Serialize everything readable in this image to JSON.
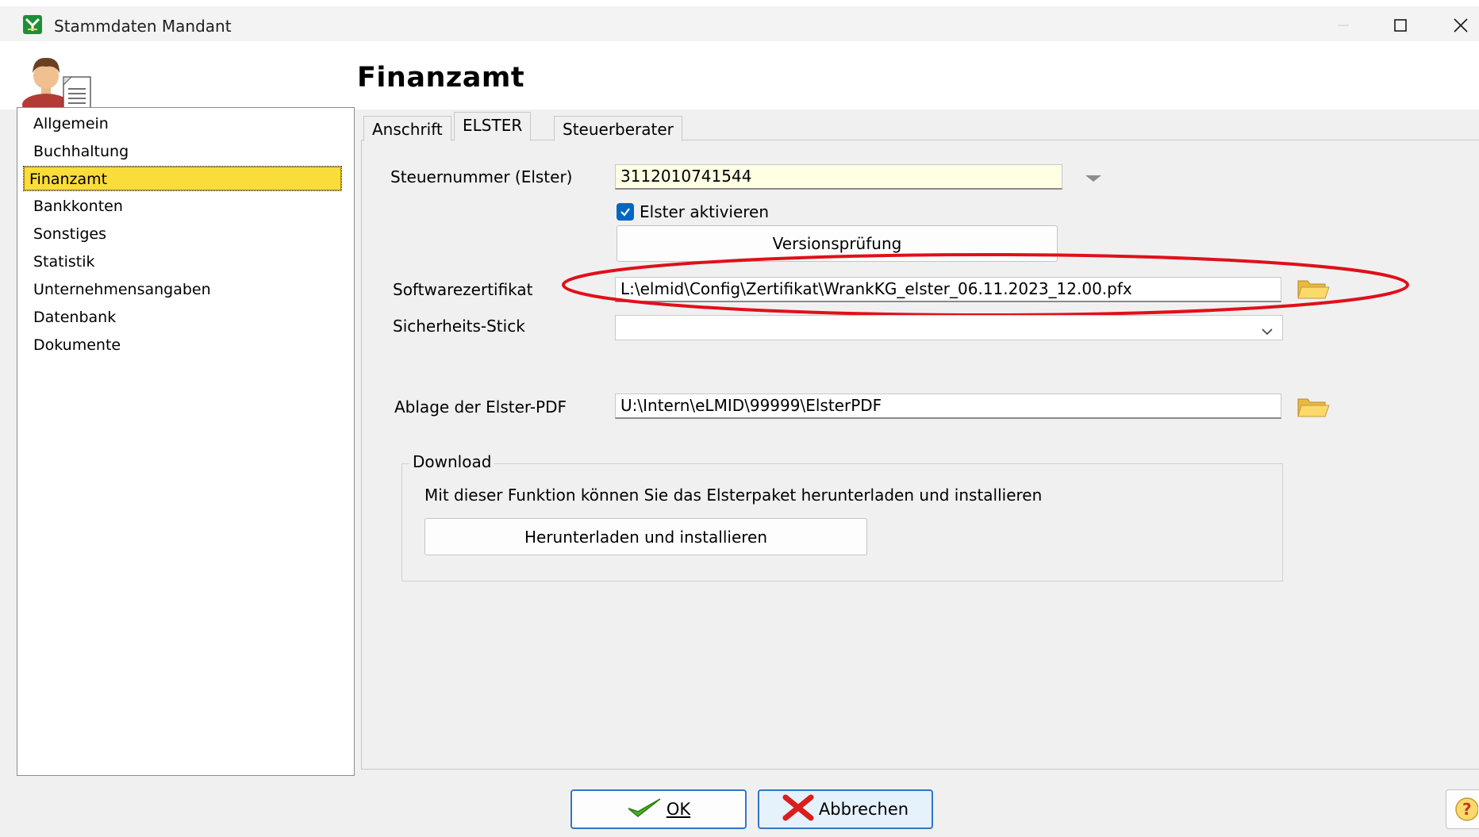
{
  "window": {
    "title": "Stammdaten Mandant",
    "minimize_icon": "minimize-icon",
    "maximize_icon": "maximize-icon",
    "close_icon": "close-icon"
  },
  "page_heading": "Finanzamt",
  "sidebar": {
    "items": [
      {
        "label": "Allgemein",
        "active": false
      },
      {
        "label": "Buchhaltung",
        "active": false
      },
      {
        "label": "Finanzamt",
        "active": true
      },
      {
        "label": "Bankkonten",
        "active": false
      },
      {
        "label": "Sonstiges",
        "active": false
      },
      {
        "label": "Statistik",
        "active": false
      },
      {
        "label": "Unternehmensangaben",
        "active": false
      },
      {
        "label": "Datenbank",
        "active": false
      },
      {
        "label": "Dokumente",
        "active": false
      }
    ],
    "active_color": "#fadc3a"
  },
  "tabs": [
    {
      "label": "Anschrift",
      "active": false
    },
    {
      "label": "ELSTER",
      "active": true
    },
    {
      "label": "Steuerberater",
      "active": false
    }
  ],
  "form": {
    "steuernummer_label": "Steuernummer (Elster)",
    "steuernummer_value": "3112010741544",
    "elster_checkbox_label": "Elster aktivieren",
    "elster_checked": true,
    "versionspruefung_button": "Versionsprüfung",
    "softwarezertifikat_label": "Softwarezertifikat",
    "softwarezertifikat_value": "L:\\elmid\\Config\\Zertifikat\\WrankKG_elster_06.11.2023_12.00.pfx",
    "sicherheitsstick_label": "Sicherheits-Stick",
    "sicherheitsstick_value": "",
    "ablage_label": "Ablage der Elster-PDF",
    "ablage_value": "U:\\Intern\\eLMID\\99999\\ElsterPDF"
  },
  "download": {
    "group_title": "Download",
    "description": "Mit dieser Funktion können Sie das Elsterpaket herunterladen und installieren",
    "button_label": "Herunterladen und installieren"
  },
  "footer": {
    "ok_label": "OK",
    "cancel_label": "Abbrechen",
    "help_icon": "help-icon"
  },
  "colors": {
    "highlight_ellipse": "#e0101a",
    "accent": "#0067c0",
    "yellow_field": "#ffffe4"
  }
}
